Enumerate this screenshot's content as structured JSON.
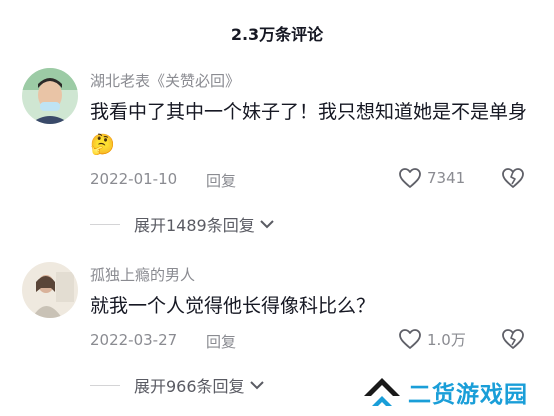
{
  "header": {
    "title": "2.3万条评论"
  },
  "comments": [
    {
      "username": "湖北老表《关赞必回》",
      "text": "我看中了其中一个妹子了！我只想知道她是不是单身",
      "emoji": "🤔",
      "date": "2022-01-10",
      "reply_label": "回复",
      "likes": "7341",
      "expand_label": "展开1489条回复"
    },
    {
      "username": "孤独上瘾的男人",
      "text": "就我一个人觉得他长得像科比么？",
      "date": "2022-03-27",
      "reply_label": "回复",
      "likes": "1.0万",
      "expand_label": "展开966条回复"
    }
  ],
  "watermark": {
    "text": "二货游戏园"
  },
  "colors": {
    "primary_text": "#161823",
    "secondary_text": "#8a8b91",
    "watermark": "#1a9ed8"
  }
}
